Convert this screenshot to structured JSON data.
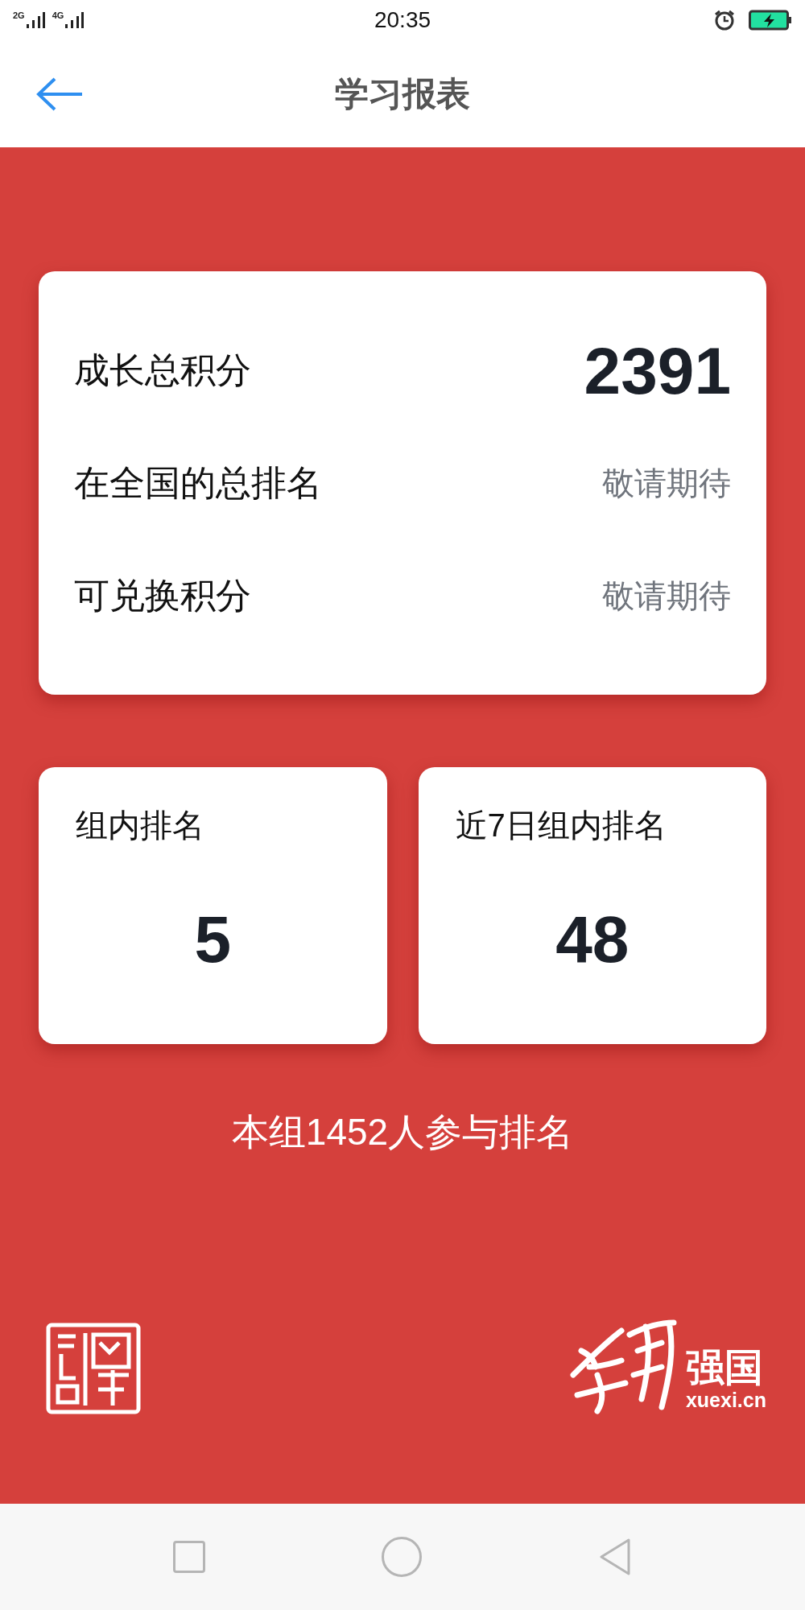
{
  "status_bar": {
    "networks": [
      "2G",
      "4G"
    ],
    "time": "20:35",
    "charging": true
  },
  "header": {
    "title": "学习报表"
  },
  "summary": [
    {
      "label": "成长总积分",
      "value": "2391",
      "kind": "score"
    },
    {
      "label": "在全国的总排名",
      "value": "敬请期待",
      "kind": "pending"
    },
    {
      "label": "可兑换积分",
      "value": "敬请期待",
      "kind": "pending"
    }
  ],
  "rank_cards": [
    {
      "label": "组内排名",
      "value": "5"
    },
    {
      "label": "近7日组内排名",
      "value": "48"
    }
  ],
  "participants": "本组1452人参与排名",
  "brand": {
    "name": "强国",
    "domain": "xuexi.cn"
  }
}
